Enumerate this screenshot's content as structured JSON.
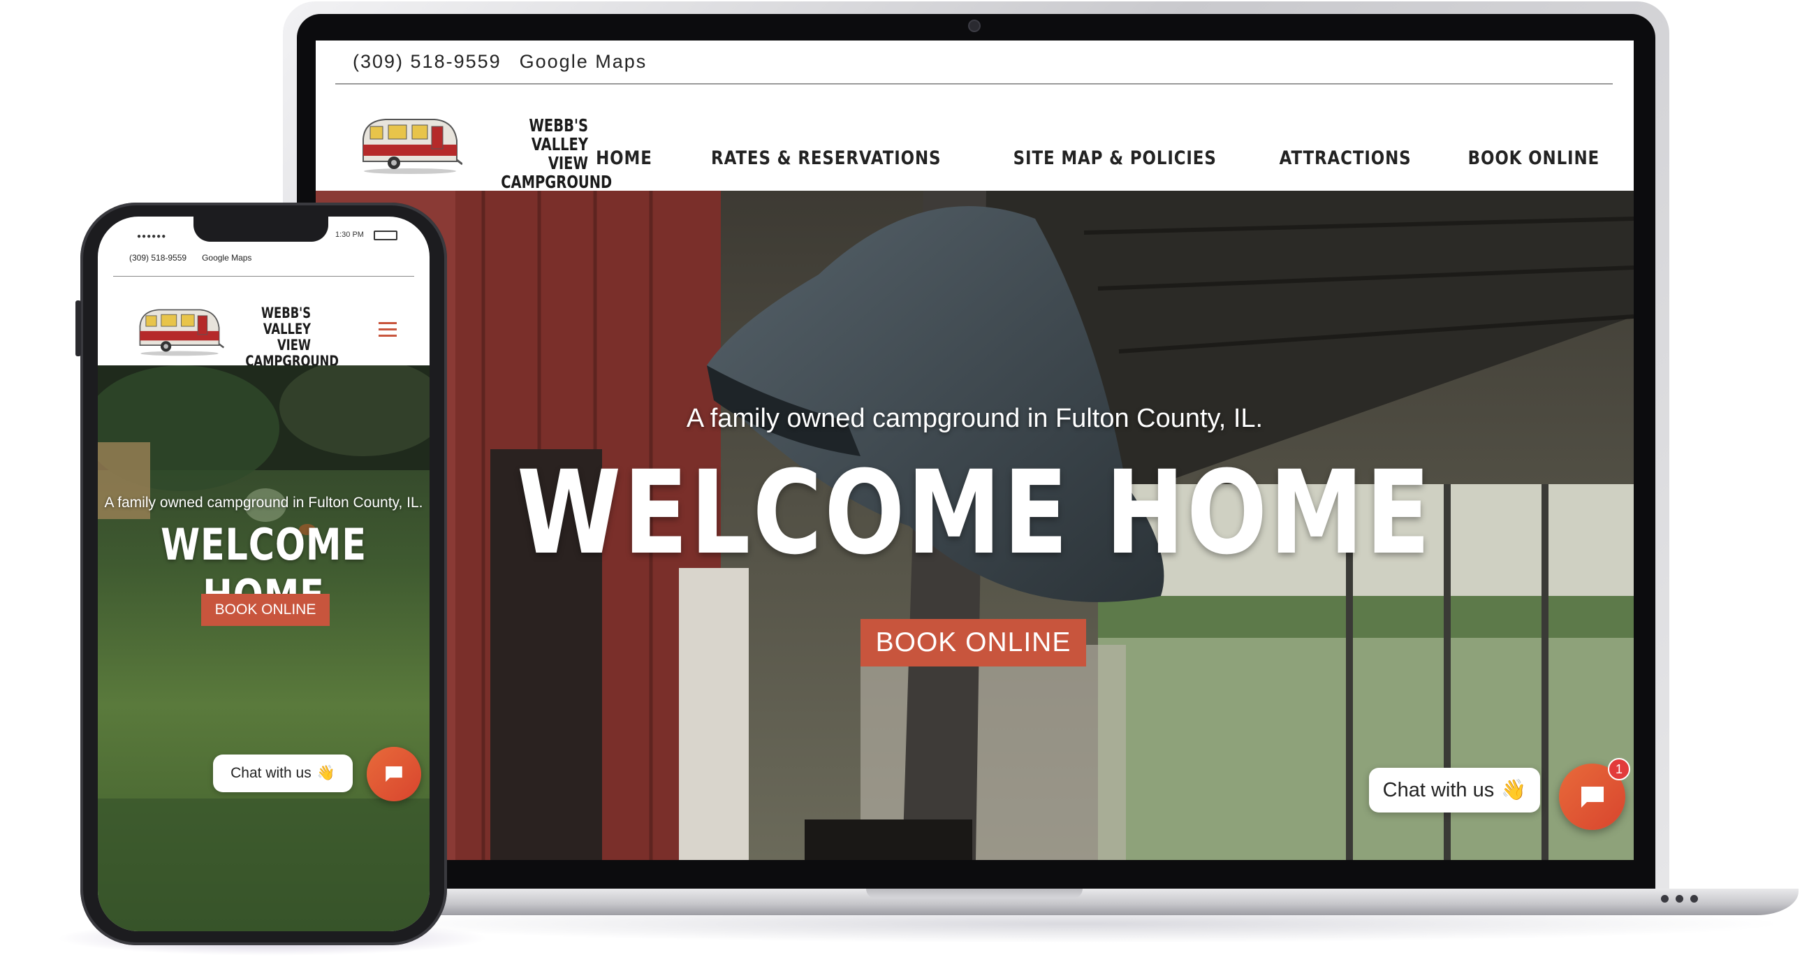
{
  "desktop": {
    "phone": "(309) 518-9559",
    "maps_link": "Google Maps",
    "logo_lines": [
      "WEBB'S",
      "VALLEY VIEW",
      "CAMPGROUND"
    ],
    "nav": [
      "HOME",
      "RATES & RESERVATIONS",
      "SITE MAP & POLICIES",
      "ATTRACTIONS",
      "BOOK ONLINE"
    ],
    "tagline": "A family owned campground in Fulton County, IL.",
    "headline": "WELCOME HOME",
    "cta": "BOOK ONLINE",
    "chat_label": "Chat with us",
    "chat_emoji": "👋",
    "chat_badge": "1"
  },
  "mobile": {
    "status_time": "1:30 PM",
    "phone": "(309) 518-9559",
    "maps_link": "Google Maps",
    "logo_lines": [
      "WEBB'S",
      "VALLEY VIEW",
      "CAMPGROUND"
    ],
    "tagline": "A family owned campground in Fulton County, IL.",
    "headline": "WELCOME HOME",
    "cta": "BOOK ONLINE",
    "chat_label": "Chat with us",
    "chat_emoji": "👋"
  },
  "colors": {
    "accent": "#c8553d",
    "chat_button": "#e0553a"
  },
  "icons": [
    "hamburger-menu-icon",
    "chat-bubble-icon",
    "waving-hand-icon",
    "camper-trailer-logo"
  ]
}
